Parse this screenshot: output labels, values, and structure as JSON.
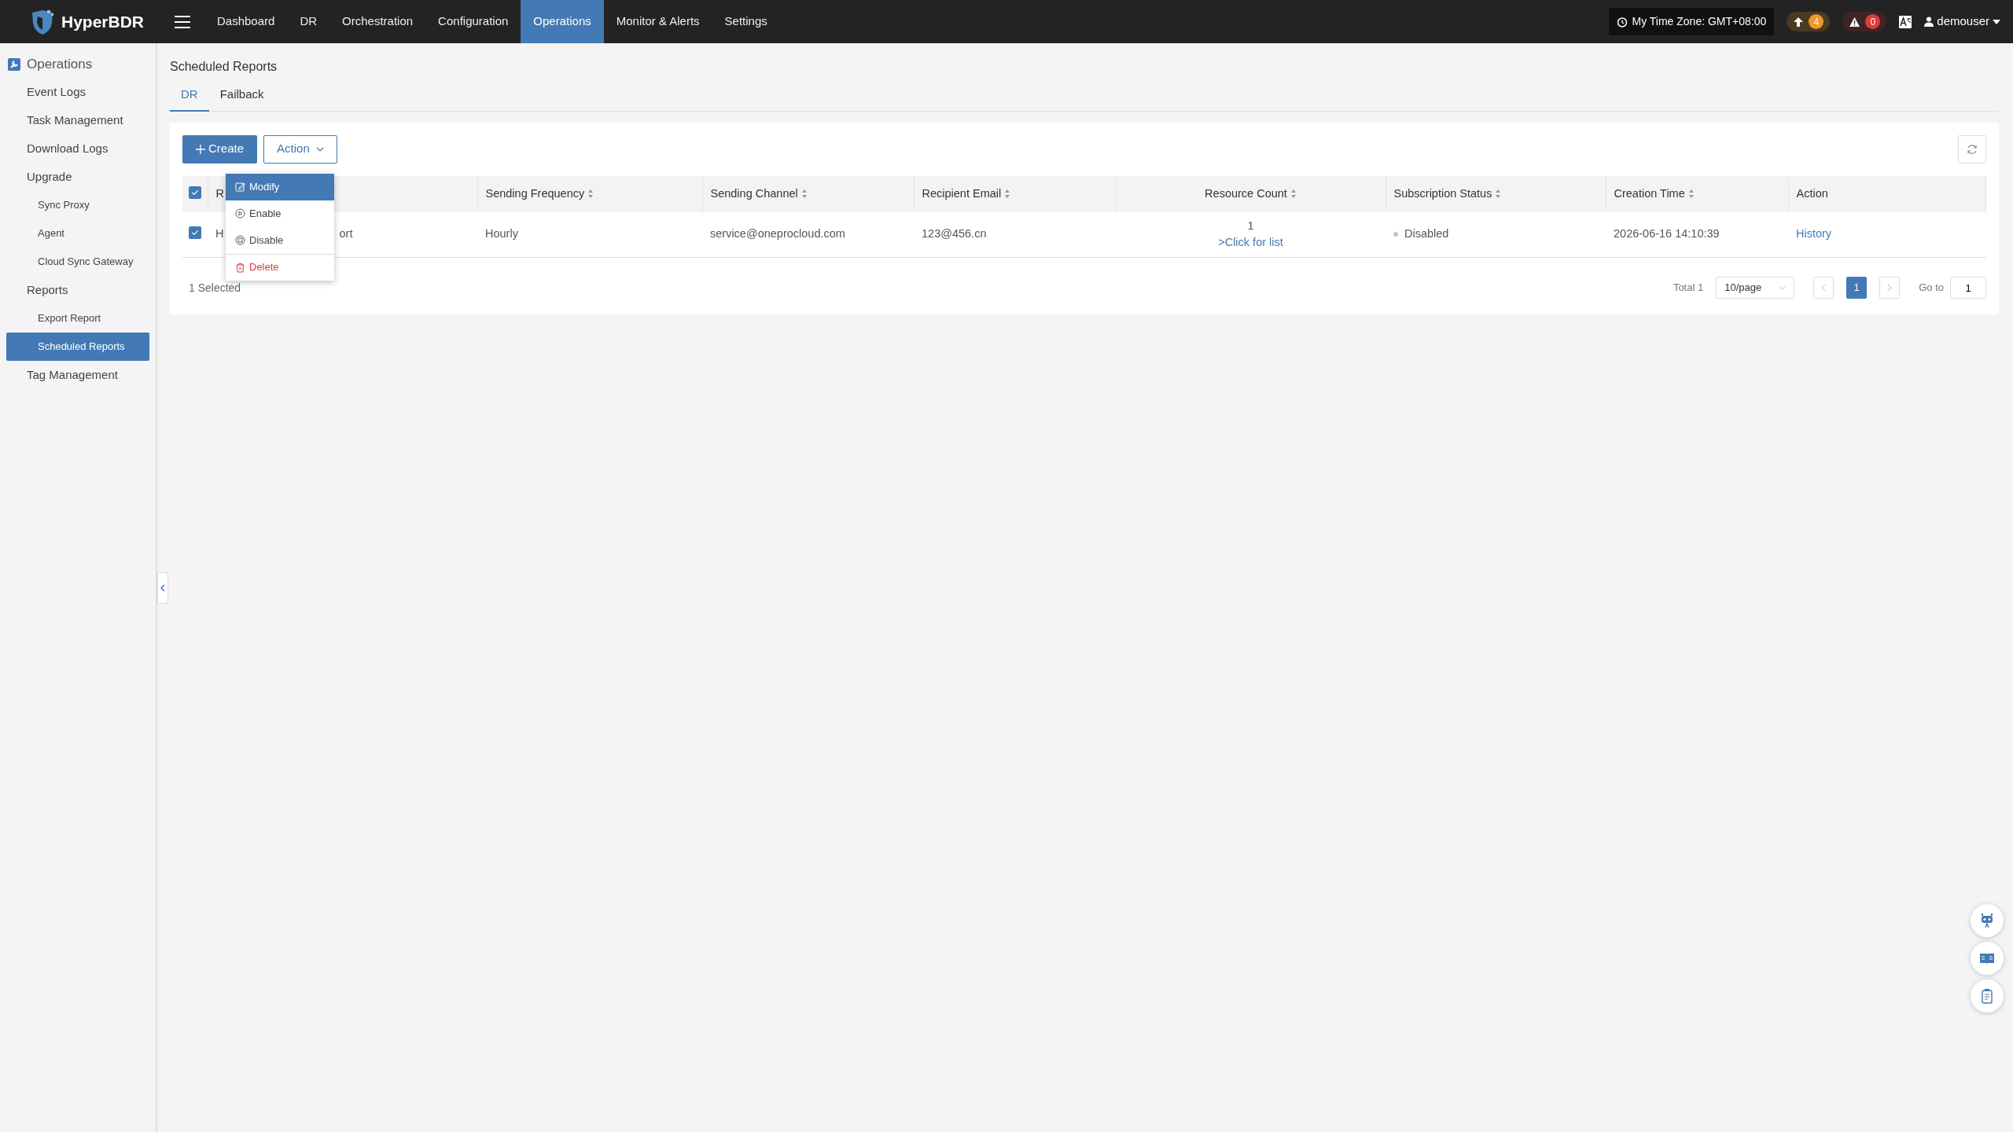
{
  "brand": {
    "name": "HyperBDR"
  },
  "nav": [
    {
      "label": "Dashboard",
      "selected": false
    },
    {
      "label": "DR",
      "selected": false
    },
    {
      "label": "Orchestration",
      "selected": false
    },
    {
      "label": "Configuration",
      "selected": false
    },
    {
      "label": "Operations",
      "selected": true
    },
    {
      "label": "Monitor & Alerts",
      "selected": false
    },
    {
      "label": "Settings",
      "selected": false
    }
  ],
  "topbar": {
    "timezone": "My Time Zone: GMT+08:00",
    "upgrade_count": "4",
    "alert_count": "0",
    "user": "demouser"
  },
  "sidebar": {
    "title": "Operations",
    "items": [
      {
        "label": "Event Logs",
        "selected": false
      },
      {
        "label": "Task Management",
        "selected": false
      },
      {
        "label": "Download Logs",
        "selected": false
      },
      {
        "label": "Upgrade",
        "selected": false,
        "children": [
          {
            "label": "Sync Proxy",
            "selected": false
          },
          {
            "label": "Agent",
            "selected": false
          },
          {
            "label": "Cloud Sync Gateway",
            "selected": false
          }
        ]
      },
      {
        "label": "Reports",
        "selected": false,
        "children": [
          {
            "label": "Export Report",
            "selected": false
          },
          {
            "label": "Scheduled Reports",
            "selected": true
          }
        ]
      },
      {
        "label": "Tag Management",
        "selected": false
      }
    ]
  },
  "page": {
    "title": "Scheduled Reports",
    "tabs": [
      {
        "label": "DR",
        "selected": true
      },
      {
        "label": "Failback",
        "selected": false
      }
    ]
  },
  "toolbar": {
    "create": "Create",
    "action": "Action"
  },
  "action_menu": [
    {
      "label": "Modify",
      "kind": "edit",
      "selected": true
    },
    {
      "label": "Enable",
      "kind": "enable",
      "selected": false
    },
    {
      "label": "Disable",
      "kind": "disable",
      "selected": false
    },
    {
      "label": "Delete",
      "kind": "delete",
      "selected": false
    }
  ],
  "table": {
    "all_checked": true,
    "columns": [
      {
        "label": "R",
        "sortable": false
      },
      {
        "label": "Sending Frequency",
        "sortable": true
      },
      {
        "label": "Sending Channel",
        "sortable": true
      },
      {
        "label": "Recipient Email",
        "sortable": true
      },
      {
        "label": "Resource Count",
        "sortable": true
      },
      {
        "label": "Subscription Status",
        "sortable": true
      },
      {
        "label": "Creation Time",
        "sortable": true
      },
      {
        "label": "Action",
        "sortable": false
      }
    ],
    "rows": [
      {
        "checked": true,
        "name_parts": [
          "H",
          "ort"
        ],
        "frequency": "Hourly",
        "channel": "service@oneprocloud.com",
        "email": "123@456.cn",
        "resource_count": "1",
        "resource_link": ">Click for list",
        "status": "Disabled",
        "created": "2026-06-16 14:10:39",
        "action": "History"
      }
    ]
  },
  "footer": {
    "selected": "1 Selected",
    "total": "Total 1",
    "page_size": "10/page",
    "pages": [
      {
        "label": "1",
        "selected": true
      }
    ],
    "goto_label": "Go to",
    "goto_value": "1"
  }
}
